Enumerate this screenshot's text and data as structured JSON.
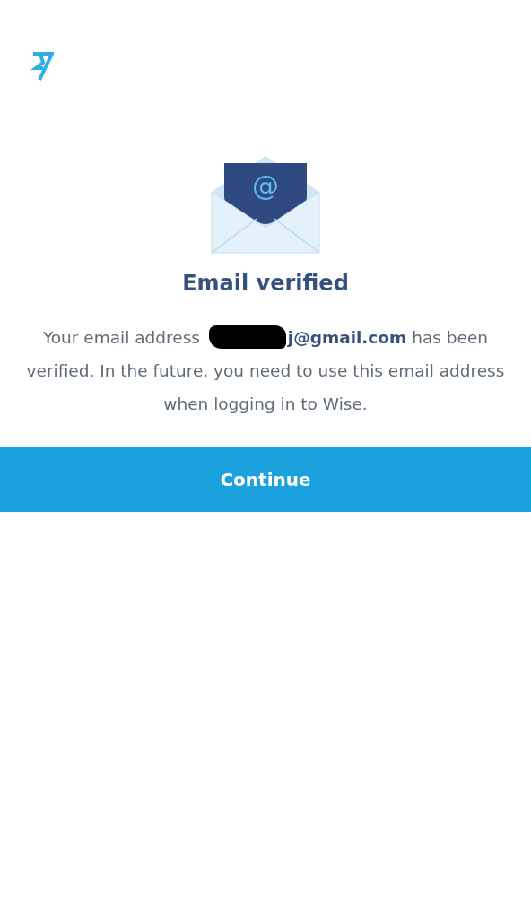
{
  "illustration": {
    "glyph": "@"
  },
  "title": "Email verified",
  "message": {
    "before": "Your email address",
    "redacted": true,
    "after": "**j@gmail.com** has been verified. In the future, you need to use this email address when logging in to Wise."
  },
  "button": {
    "label": "Continue"
  }
}
